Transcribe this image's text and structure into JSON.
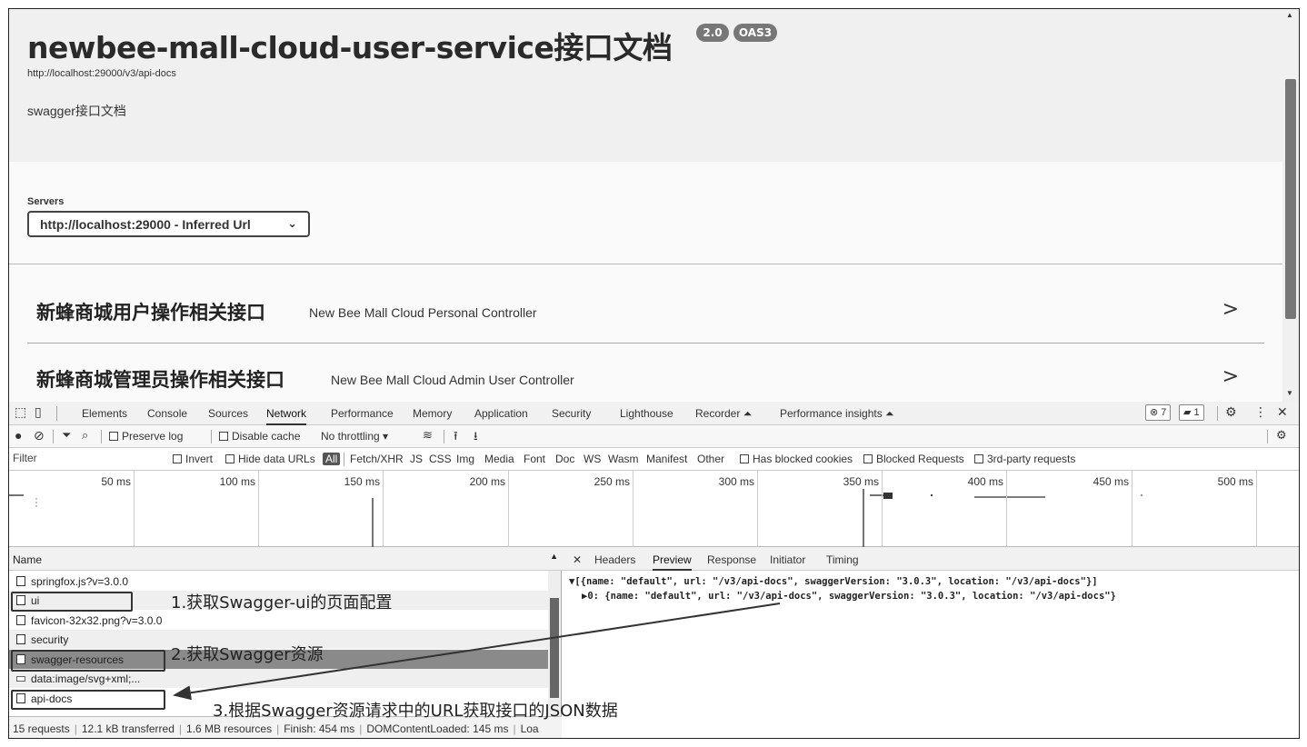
{
  "swagger": {
    "title": "newbee-mall-cloud-user-service接口文档",
    "version_badge": "2.0",
    "oas_badge": "OAS3",
    "url": "http://localhost:29000/v3/api-docs",
    "description": "swagger接口文档",
    "servers_label": "Servers",
    "server_selected": "http://localhost:29000 - Inferred Url",
    "groups": [
      {
        "name": "新蜂商城用户操作相关接口",
        "desc": "New Bee Mall Cloud Personal Controller"
      },
      {
        "name": "新蜂商城管理员操作相关接口",
        "desc": "New Bee Mall Cloud Admin User Controller"
      }
    ]
  },
  "devtools": {
    "tabs": [
      "Elements",
      "Console",
      "Sources",
      "Network",
      "Performance",
      "Memory",
      "Application",
      "Security",
      "Lighthouse",
      "Recorder ⏶",
      "Performance insights ⏶"
    ],
    "active_tab": "Network",
    "error_count": "7",
    "message_count": "1",
    "toolbar": {
      "preserve_log": "Preserve log",
      "disable_cache": "Disable cache",
      "throttling": "No throttling"
    },
    "filter": {
      "placeholder": "Filter",
      "invert": "Invert",
      "hide_data_urls": "Hide data URLs",
      "types": [
        "All",
        "Fetch/XHR",
        "JS",
        "CSS",
        "Img",
        "Media",
        "Font",
        "Doc",
        "WS",
        "Wasm",
        "Manifest",
        "Other"
      ],
      "has_blocked_cookies": "Has blocked cookies",
      "blocked_requests": "Blocked Requests",
      "third_party": "3rd-party requests"
    },
    "timeline_ticks": [
      "50 ms",
      "100 ms",
      "150 ms",
      "200 ms",
      "250 ms",
      "300 ms",
      "350 ms",
      "400 ms",
      "450 ms",
      "500 ms"
    ],
    "name_header": "Name",
    "requests": [
      {
        "name": "springfox.js?v=3.0.0"
      },
      {
        "name": "ui"
      },
      {
        "name": "favicon-32x32.png?v=3.0.0"
      },
      {
        "name": "security"
      },
      {
        "name": "swagger-resources"
      },
      {
        "name": "data:image/svg+xml;..."
      },
      {
        "name": "api-docs"
      }
    ],
    "detail_tabs": [
      "Headers",
      "Preview",
      "Response",
      "Initiator",
      "Timing"
    ],
    "detail_active": "Preview",
    "preview_line1": "▼[{name: \"default\", url: \"/v3/api-docs\", swaggerVersion: \"3.0.3\", location: \"/v3/api-docs\"}]",
    "preview_line2": "▶0: {name: \"default\", url: \"/v3/api-docs\", swaggerVersion: \"3.0.3\", location: \"/v3/api-docs\"}",
    "status": {
      "requests": "15 requests",
      "transferred": "12.1 kB transferred",
      "resources": "1.6 MB resources",
      "finish": "Finish: 454 ms",
      "dcl": "DOMContentLoaded: 145 ms",
      "load": "Loa"
    }
  },
  "annotations": {
    "step1": "1.获取Swagger-ui的页面配置",
    "step2": "2.获取Swagger资源",
    "step3": "3.根据Swagger资源请求中的URL获取接口的JSON数据"
  }
}
